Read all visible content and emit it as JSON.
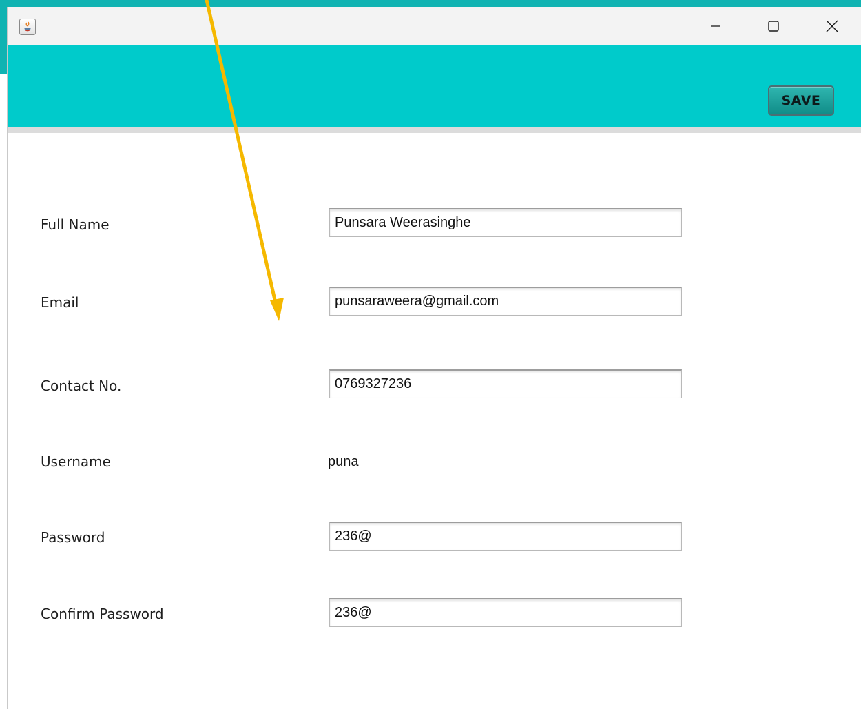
{
  "window": {
    "title": "",
    "icon": "java-icon",
    "controls": {
      "minimize_icon": "minimize-icon",
      "maximize_icon": "maximize-icon",
      "close_icon": "close-icon"
    }
  },
  "header": {
    "background": "#00cbcb",
    "save_label": "SAVE"
  },
  "form": {
    "full_name": {
      "label": "Full Name",
      "value": "Punsara Weerasinghe"
    },
    "email": {
      "label": "Email",
      "value": "punsaraweera@gmail.com"
    },
    "contact": {
      "label": "Contact No.",
      "value": "0769327236"
    },
    "username": {
      "label": "Username",
      "value": "puna"
    },
    "password": {
      "label": "Password",
      "value": "236@"
    },
    "confirm_password": {
      "label": "Confirm Password",
      "value": "236@"
    }
  },
  "annotation": {
    "color": "#f5b800"
  }
}
